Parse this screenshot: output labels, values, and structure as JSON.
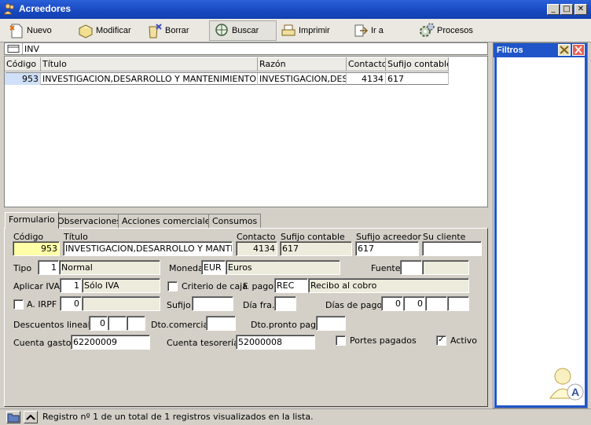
{
  "window": {
    "title": "Acreedores",
    "min_btn": "_",
    "max_btn": "□",
    "close_btn": "✕"
  },
  "toolbar": {
    "nuevo": "Nuevo",
    "modificar": "Modificar",
    "borrar": "Borrar",
    "buscar": "Buscar",
    "imprimir": "Imprimir",
    "ir_a": "Ir a",
    "procesos": "Procesos"
  },
  "search": {
    "value": "INV"
  },
  "list": {
    "columns": [
      "Código",
      "Título",
      "Razón",
      "Contacto",
      "Sufijo contable"
    ],
    "rows": [
      [
        "953",
        "INVESTIGACION,DESARROLLO Y MANTENIMIENTO DE",
        "INVESTIGACION,DESA",
        "4134",
        "617"
      ]
    ]
  },
  "filters": {
    "title": "Filtros"
  },
  "tabs": [
    "Formulario",
    "Observaciones",
    "Acciones comerciales",
    "Consumos"
  ],
  "form": {
    "codigo_label": "Código",
    "codigo": "953",
    "titulo_label": "Título",
    "titulo": "INVESTIGACION,DESARROLLO Y MANTE",
    "contacto_label": "Contacto",
    "contacto": "4134",
    "sufijo_contable_label": "Sufijo contable",
    "sufijo_contable": "617",
    "sufijo_acreedor_label": "Sufijo acreedor",
    "sufijo_acreedor": "617",
    "su_cliente_label": "Su cliente",
    "su_cliente": "",
    "tipo_label": "Tipo",
    "tipo_code": "1",
    "tipo_desc": "Normal",
    "moneda_label": "Moneda",
    "moneda_code": "EUR",
    "moneda_desc": "Euros",
    "fuente_label": "Fuente",
    "aplicar_iva_label": "Aplicar IVA",
    "iva_code": "1",
    "iva_desc": "Sólo IVA",
    "criterio_caja_label": "Criterio de caja",
    "fpago_label": "F. pago",
    "fpago_code": "REC",
    "fpago_desc": "Recibo al cobro",
    "airpf_label": "A. IRPF",
    "irpf_code": "0",
    "sufijo_label": "Sufijo",
    "dia_fra_label": "Día fra.",
    "dias_pago_label": "Días de pago",
    "dias_pago_1": "0",
    "dias_pago_2": "0",
    "descuentos_label": "Descuentos lineales",
    "descuento_1": "0",
    "dto_comercial_label": "Dto.comercial",
    "dto_pronto_label": "Dto.pronto pago",
    "cuenta_gastos_label": "Cuenta gastos",
    "cuenta_gastos": "62200009",
    "cuenta_tesoreria_label": "Cuenta tesorería",
    "cuenta_tesoreria": "52000008",
    "portes_label": "Portes pagados",
    "activo_label": "Activo",
    "activo_mark": "✓"
  },
  "status": {
    "text": "Registro nº 1 de un total de 1 registros visualizados en la lista."
  }
}
